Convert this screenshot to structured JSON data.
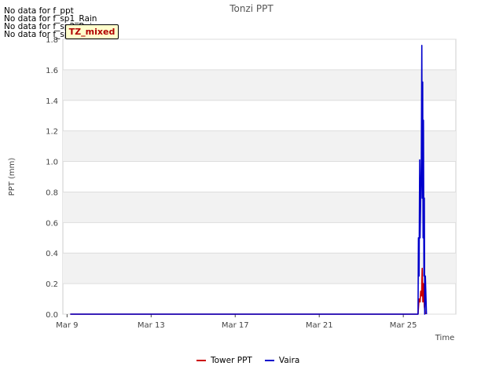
{
  "notes": {
    "nodata": [
      "No data for f_ppt",
      "No data for f_sp1_Rain",
      "No data for f_sp2_Rain",
      "No data for f_sp3_Rain"
    ],
    "badge": "TZ_mixed"
  },
  "chart_data": {
    "type": "line",
    "title": "Tonzi PPT",
    "xlabel": "Time",
    "ylabel": "PPT (mm)",
    "xlim": [
      8.8,
      27.5
    ],
    "ylim": [
      0,
      1.8
    ],
    "x_ticks": [
      9,
      13,
      17,
      21,
      25
    ],
    "x_tick_labels": [
      "Mar 9",
      "Mar 13",
      "Mar 17",
      "Mar 21",
      "Mar 25"
    ],
    "y_ticks": [
      0.0,
      0.2,
      0.4,
      0.6,
      0.8,
      1.0,
      1.2,
      1.4,
      1.6,
      1.8
    ],
    "y_tick_labels": [
      "0.0",
      "0.2",
      "0.4",
      "0.6",
      "0.8",
      "1.0",
      "1.2",
      "1.4",
      "1.6",
      "1.8"
    ],
    "grid": true,
    "legend_position": "bottom",
    "series": [
      {
        "name": "Tower PPT",
        "color": "#cc0000",
        "x": [
          9.15,
          25.7,
          25.75,
          25.8,
          25.83,
          25.87,
          25.9,
          25.93,
          25.96,
          26.0,
          26.05
        ],
        "y": [
          0,
          0,
          0.1,
          0.08,
          0.15,
          0.12,
          0.3,
          0.08,
          0.2,
          0.05,
          0
        ]
      },
      {
        "name": "Vaira",
        "color": "#0000cc",
        "x": [
          9.15,
          25.7,
          25.72,
          25.75,
          25.78,
          25.8,
          25.83,
          25.86,
          25.88,
          25.9,
          25.92,
          25.94,
          25.96,
          25.98,
          26.0,
          26.02,
          26.05,
          26.1
        ],
        "y": [
          0,
          0,
          0.5,
          0.25,
          1.01,
          0.5,
          0.76,
          1.02,
          1.76,
          0.76,
          1.52,
          0.5,
          1.27,
          0.25,
          0.76,
          0.0,
          0.25,
          0
        ]
      }
    ]
  }
}
